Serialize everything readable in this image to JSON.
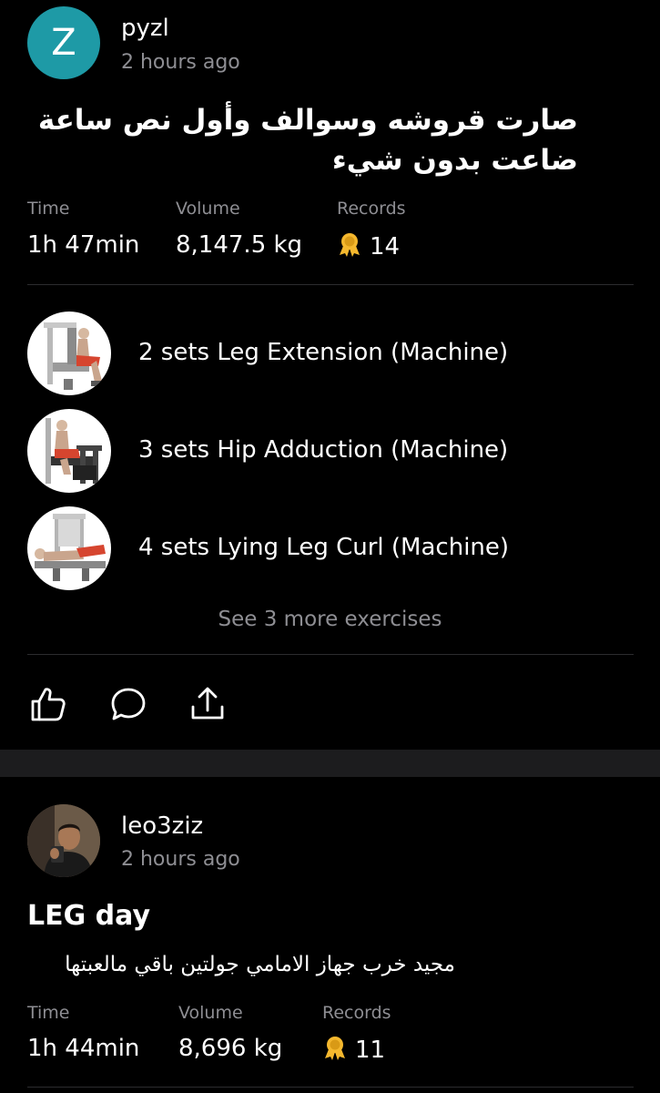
{
  "feed": {
    "posts": [
      {
        "avatar_letter": "Z",
        "avatar_color": "#1e9aa6",
        "username": "pyzl",
        "time_ago": "2 hours ago",
        "title": "صارت قروشه وسوالف وأول نص ساعة ضاعت بدون شيء",
        "stats": {
          "time_label": "Time",
          "time_value": "1h 47min",
          "volume_label": "Volume",
          "volume_value": "8,147.5 kg",
          "records_label": "Records",
          "records_value": "14",
          "records_icon": "medal-icon"
        },
        "exercises": [
          {
            "label": "2 sets Leg Extension (Machine)",
            "icon": "leg-extension-machine"
          },
          {
            "label": "3 sets Hip Adduction (Machine)",
            "icon": "hip-adduction-machine"
          },
          {
            "label": "4 sets Lying Leg Curl (Machine)",
            "icon": "lying-leg-curl-machine"
          }
        ],
        "see_more": "See 3 more exercises",
        "actions": [
          "like-icon",
          "comment-icon",
          "share-icon"
        ]
      },
      {
        "username": "leo3ziz",
        "time_ago": "2 hours ago",
        "title": "LEG day",
        "description": "مجيد خرب جهاز الامامي جولتين باقي مالعبتها",
        "stats": {
          "time_label": "Time",
          "time_value": "1h 44min",
          "volume_label": "Volume",
          "volume_value": "8,696 kg",
          "records_label": "Records",
          "records_value": "11",
          "records_icon": "medal-icon"
        }
      }
    ]
  },
  "colors": {
    "background": "#000000",
    "separator": "#1c1c1e",
    "secondary_text": "#8e8e93",
    "medal": "#f5b82e"
  }
}
